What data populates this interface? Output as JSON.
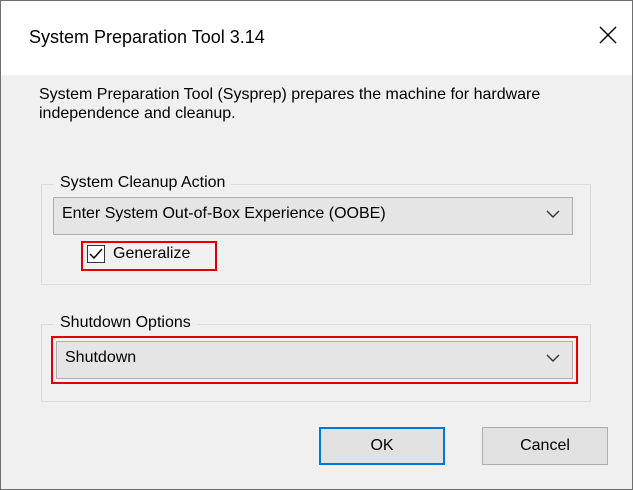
{
  "window": {
    "title": "System Preparation Tool 3.14"
  },
  "description": "System Preparation Tool (Sysprep) prepares the machine for hardware independence and cleanup.",
  "cleanup_group": {
    "legend": "System Cleanup Action",
    "selected": "Enter System Out-of-Box Experience (OOBE)",
    "generalize_label": "Generalize",
    "generalize_checked": true
  },
  "shutdown_group": {
    "legend": "Shutdown Options",
    "selected": "Shutdown"
  },
  "buttons": {
    "ok": "OK",
    "cancel": "Cancel"
  },
  "colors": {
    "highlight": "#e00000",
    "default_button_border": "#0078d7",
    "window_bg": "#f0f0f0"
  },
  "icons": [
    "close-icon",
    "chevron-down-icon",
    "checkmark-icon"
  ]
}
